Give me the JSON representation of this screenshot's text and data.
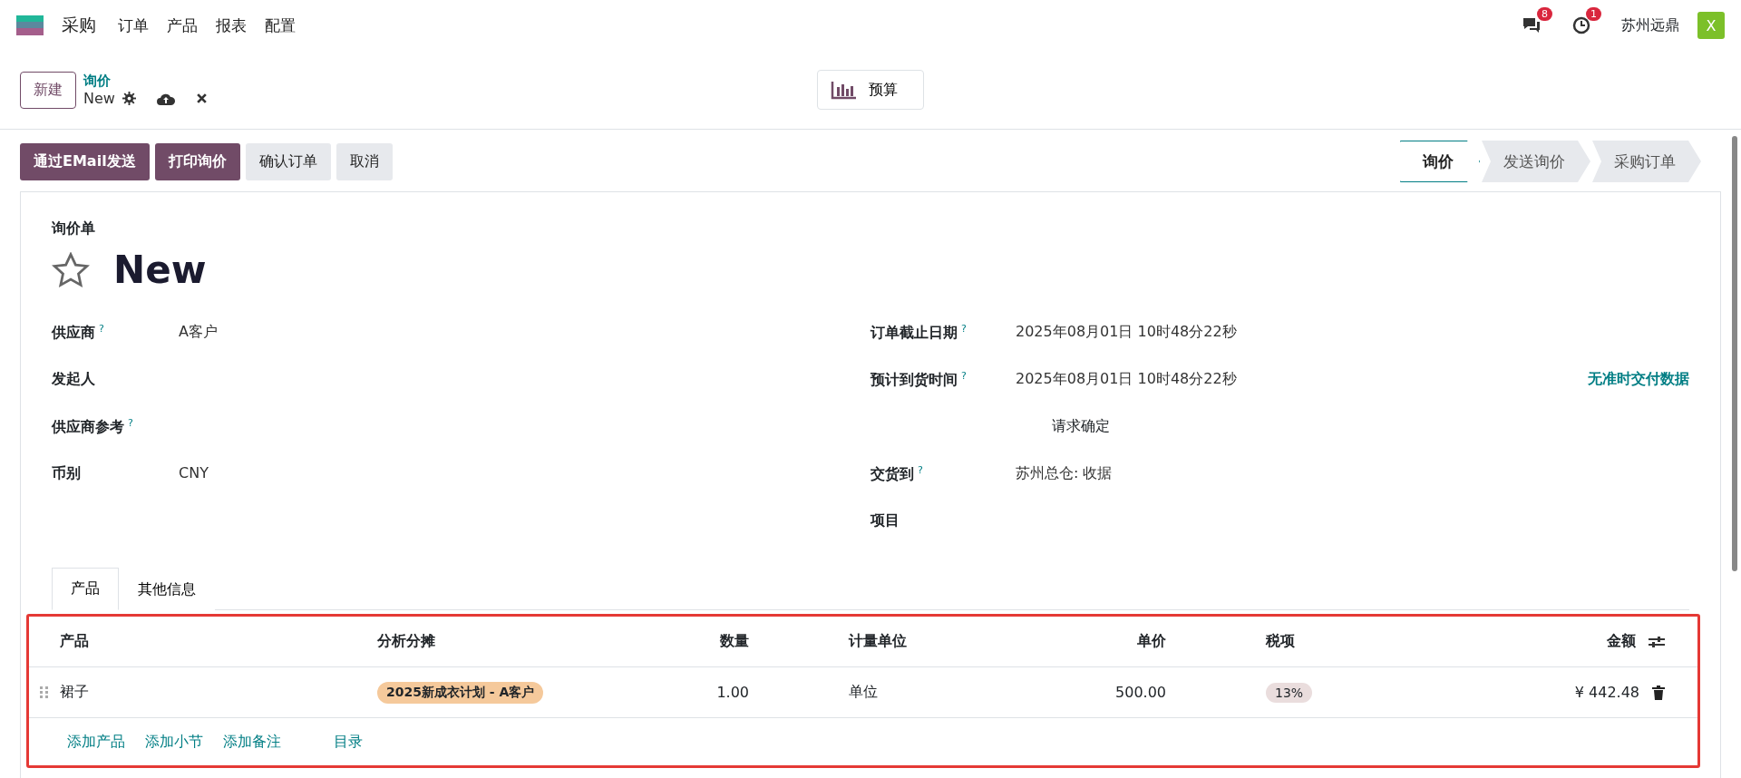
{
  "navbar": {
    "app": "采购",
    "menu": [
      "订单",
      "产品",
      "报表",
      "配置"
    ],
    "messages_count": "8",
    "activities_count": "1",
    "company": "苏州远鼎",
    "avatar": "X"
  },
  "control_panel": {
    "new_button": "新建",
    "breadcrumb": "询价",
    "record": "New",
    "budget_button": "预算"
  },
  "actions": [
    {
      "label": "通过EMail发送",
      "kind": "primary"
    },
    {
      "label": "打印询价",
      "kind": "primary"
    },
    {
      "label": "确认订单",
      "kind": "secondary"
    },
    {
      "label": "取消",
      "kind": "secondary"
    }
  ],
  "statusbar": [
    {
      "label": "询价",
      "selected": true
    },
    {
      "label": "发送询价",
      "selected": false
    },
    {
      "label": "采购订单",
      "selected": false
    }
  ],
  "form": {
    "subtitle": "询价单",
    "title": "New",
    "favorite": false,
    "left_fields": [
      {
        "label": "供应商",
        "help": "?",
        "value": "A客户"
      },
      {
        "label": "发起人"
      },
      {
        "label": "供应商参考",
        "help": "?"
      },
      {
        "label": "币别",
        "value": "CNY"
      }
    ],
    "right_fields": [
      {
        "label": "订单截止日期",
        "help": "?",
        "value": "2025年08月01日 10时48分22秒"
      },
      {
        "label": "预计到货时间",
        "help": "?",
        "value": "2025年08月01日 10时48分22秒",
        "extra": "无准时交付数据",
        "note": "请求确定"
      },
      {
        "label": "交货到",
        "help": "?",
        "value": "苏州总仓: 收据"
      },
      {
        "label": "项目"
      }
    ]
  },
  "tabs": [
    {
      "label": "产品",
      "selected": true
    },
    {
      "label": "其他信息",
      "selected": false
    }
  ],
  "table": {
    "columns": [
      "产品",
      "分析分摊",
      "数量",
      "计量单位",
      "单价",
      "税项",
      "金额"
    ],
    "rows": [
      {
        "product": "裙子",
        "analytic": "2025新成衣计划 - A客户",
        "quantity": "1.00",
        "uom": "单位",
        "price": "500.00",
        "tax": "13%",
        "amount": "¥ 442.48"
      }
    ],
    "footer_links": [
      "添加产品",
      "添加小节",
      "添加备注",
      "目录"
    ]
  }
}
